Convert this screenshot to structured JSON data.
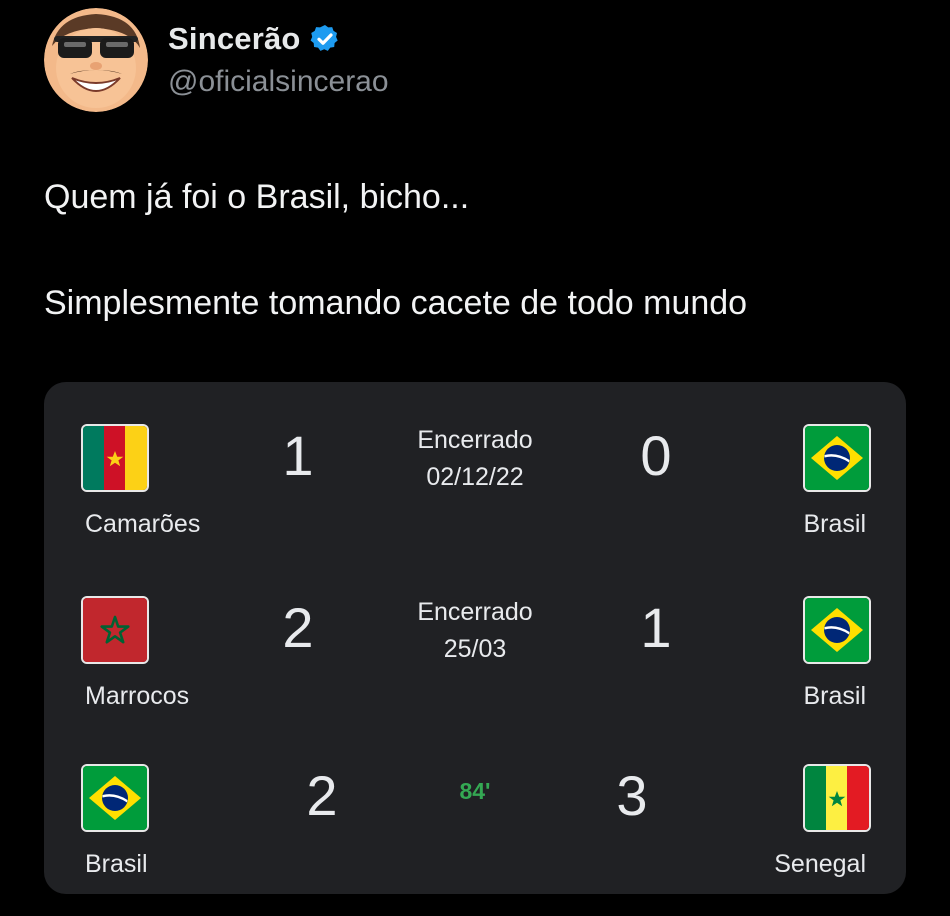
{
  "post": {
    "author": {
      "display_name": "Sincerão",
      "handle": "@oficialsincerao",
      "verified": true,
      "avatar_icon": "cartoon-face-sunglasses"
    },
    "text_lines": [
      "Quem já foi o Brasil, bicho...",
      "Simplesmente tomando cacete de todo mundo"
    ]
  },
  "scores_card": {
    "matches": [
      {
        "home_team": "Camarões",
        "home_flag": "cameroon-flag",
        "home_score": "1",
        "status_line1": "Encerrado",
        "status_line2": "02/12/22",
        "away_score": "0",
        "away_team": "Brasil",
        "away_flag": "brazil-flag"
      },
      {
        "home_team": "Marrocos",
        "home_flag": "morocco-flag",
        "home_score": "2",
        "status_line1": "Encerrado",
        "status_line2": "25/03",
        "away_score": "1",
        "away_team": "Brasil",
        "away_flag": "brazil-flag"
      },
      {
        "home_team": "Brasil",
        "home_flag": "brazil-flag",
        "home_score": "2",
        "live_minute": "84'",
        "away_score": "3",
        "away_team": "Senegal",
        "away_flag": "senegal-flag"
      }
    ]
  },
  "colors": {
    "background": "#000000",
    "card_background": "#202124",
    "verified_blue": "#1d9bf0",
    "live_green": "#34a853",
    "handle_gray": "#8b9096"
  }
}
